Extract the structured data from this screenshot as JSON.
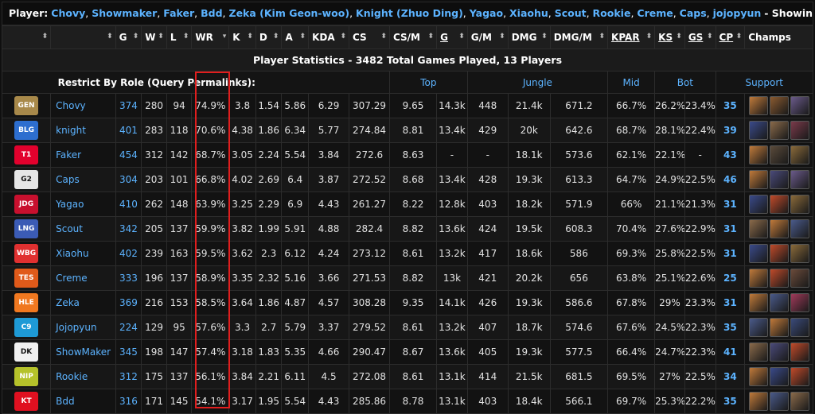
{
  "filter_bar": {
    "label": "Player:",
    "players": [
      "Chovy",
      "Showmaker",
      "Faker",
      "Bdd",
      "Zeka (Kim Geon-woo)",
      "Knight (Zhuo Ding)",
      "Yagao",
      "Xiaohu",
      "Scout",
      "Rookie",
      "Creme",
      "Caps",
      "jojopyun"
    ],
    "suffix": "- Showing Values Per Game"
  },
  "caption": "Player Statistics - 3482 Total Games Played, 13 Players",
  "role_bar": {
    "label": "Restrict By Role (Query Permalinks):",
    "roles": [
      "Top",
      "Jungle",
      "Mid",
      "Bot",
      "Support"
    ]
  },
  "columns": [
    "",
    "",
    "G",
    "W",
    "L",
    "WR",
    "K",
    "D",
    "A",
    "KDA",
    "CS",
    "CS/M",
    "G",
    "G/M",
    "DMG",
    "DMG/M",
    "KPAR",
    "KS",
    "GS",
    "CP",
    "Champs"
  ],
  "sorted_column": "WR",
  "rows": [
    {
      "team": "GEN",
      "team_color": "#a8894a",
      "name": "Chovy",
      "g": "374",
      "w": "280",
      "l": "94",
      "wr": "74.9%",
      "k": "3.8",
      "d": "1.54",
      "a": "5.86",
      "kda": "6.29",
      "cs": "307.29",
      "csm": "9.65",
      "gold": "14.3k",
      "gm": "448",
      "dmg": "21.4k",
      "dmgm": "671.2",
      "kpar": "66.7%",
      "ks": "26.2%",
      "gs": "23.4%",
      "cp": "35",
      "champs": [
        "#c07a3a",
        "#8a5a30",
        "#6a5a8a"
      ]
    },
    {
      "team": "BLG",
      "team_color": "#2d6ecf",
      "name": "knight",
      "g": "401",
      "w": "283",
      "l": "118",
      "wr": "70.6%",
      "k": "4.38",
      "d": "1.86",
      "a": "6.34",
      "kda": "5.77",
      "cs": "274.84",
      "csm": "8.81",
      "gold": "13.4k",
      "gm": "429",
      "dmg": "20k",
      "dmgm": "642.6",
      "kpar": "68.7%",
      "ks": "28.1%",
      "gs": "22.4%",
      "cp": "39",
      "champs": [
        "#3a4a8a",
        "#8a6a4a",
        "#7a3a4a"
      ]
    },
    {
      "team": "T1",
      "team_color": "#e2012d",
      "name": "Faker",
      "g": "454",
      "w": "312",
      "l": "142",
      "wr": "68.7%",
      "k": "3.05",
      "d": "2.24",
      "a": "5.54",
      "kda": "3.84",
      "cs": "272.6",
      "csm": "8.63",
      "gold": "-",
      "gm": "-",
      "dmg": "18.1k",
      "dmgm": "573.6",
      "kpar": "62.1%",
      "ks": "22.1%",
      "gs": "-",
      "cp": "43",
      "champs": [
        "#c07a3a",
        "#5a4a3a",
        "#8a6a3a"
      ]
    },
    {
      "team": "G2",
      "team_color": "#e6e6e6",
      "name": "Caps",
      "g": "304",
      "w": "203",
      "l": "101",
      "wr": "66.8%",
      "k": "4.02",
      "d": "2.69",
      "a": "6.4",
      "kda": "3.87",
      "cs": "272.52",
      "csm": "8.68",
      "gold": "13.4k",
      "gm": "428",
      "dmg": "19.3k",
      "dmgm": "613.3",
      "kpar": "64.7%",
      "ks": "24.9%",
      "gs": "22.5%",
      "cp": "46",
      "champs": [
        "#c07a3a",
        "#4a4a7a",
        "#6a5a8a"
      ]
    },
    {
      "team": "JDG",
      "team_color": "#c8102e",
      "name": "Yagao",
      "g": "410",
      "w": "262",
      "l": "148",
      "wr": "63.9%",
      "k": "3.25",
      "d": "2.29",
      "a": "6.9",
      "kda": "4.43",
      "cs": "261.27",
      "csm": "8.22",
      "gold": "12.8k",
      "gm": "403",
      "dmg": "18.2k",
      "dmgm": "571.9",
      "kpar": "66%",
      "ks": "21.1%",
      "gs": "21.3%",
      "cp": "31",
      "champs": [
        "#3a4a8a",
        "#c04a2a",
        "#8a6a3a"
      ]
    },
    {
      "team": "LNG",
      "team_color": "#3b5bb5",
      "name": "Scout",
      "g": "342",
      "w": "205",
      "l": "137",
      "wr": "59.9%",
      "k": "3.82",
      "d": "1.99",
      "a": "5.91",
      "kda": "4.88",
      "cs": "282.4",
      "csm": "8.82",
      "gold": "13.6k",
      "gm": "424",
      "dmg": "19.5k",
      "dmgm": "608.3",
      "kpar": "70.4%",
      "ks": "27.6%",
      "gs": "22.9%",
      "cp": "31",
      "champs": [
        "#8a6a4a",
        "#c07a3a",
        "#4a5a8a"
      ]
    },
    {
      "team": "WBG",
      "team_color": "#e03030",
      "name": "Xiaohu",
      "g": "402",
      "w": "239",
      "l": "163",
      "wr": "59.5%",
      "k": "3.62",
      "d": "2.3",
      "a": "6.12",
      "kda": "4.24",
      "cs": "273.12",
      "csm": "8.61",
      "gold": "13.2k",
      "gm": "417",
      "dmg": "18.6k",
      "dmgm": "586",
      "kpar": "69.3%",
      "ks": "25.8%",
      "gs": "22.5%",
      "cp": "31",
      "champs": [
        "#3a4a8a",
        "#c04a2a",
        "#8a6a3a"
      ]
    },
    {
      "team": "TES",
      "team_color": "#e05a1a",
      "name": "Creme",
      "g": "333",
      "w": "196",
      "l": "137",
      "wr": "58.9%",
      "k": "3.35",
      "d": "2.32",
      "a": "5.16",
      "kda": "3.66",
      "cs": "271.53",
      "csm": "8.82",
      "gold": "13k",
      "gm": "421",
      "dmg": "20.2k",
      "dmgm": "656",
      "kpar": "63.8%",
      "ks": "25.1%",
      "gs": "22.6%",
      "cp": "25",
      "champs": [
        "#c07a3a",
        "#c04a2a",
        "#6a4a3a"
      ]
    },
    {
      "team": "HLE",
      "team_color": "#f07820",
      "name": "Zeka",
      "g": "369",
      "w": "216",
      "l": "153",
      "wr": "58.5%",
      "k": "3.64",
      "d": "1.86",
      "a": "4.87",
      "kda": "4.57",
      "cs": "308.28",
      "csm": "9.35",
      "gold": "14.1k",
      "gm": "426",
      "dmg": "19.3k",
      "dmgm": "586.6",
      "kpar": "67.8%",
      "ks": "29%",
      "gs": "23.3%",
      "cp": "31",
      "champs": [
        "#c07a3a",
        "#4a5a8a",
        "#a03a5a"
      ]
    },
    {
      "team": "C9",
      "team_color": "#1e9ad6",
      "name": "Jojopyun",
      "g": "224",
      "w": "129",
      "l": "95",
      "wr": "57.6%",
      "k": "3.3",
      "d": "2.7",
      "a": "5.79",
      "kda": "3.37",
      "cs": "279.52",
      "csm": "8.61",
      "gold": "13.2k",
      "gm": "407",
      "dmg": "18.7k",
      "dmgm": "574.6",
      "kpar": "67.6%",
      "ks": "24.5%",
      "gs": "22.3%",
      "cp": "35",
      "champs": [
        "#4a5a8a",
        "#c07a3a",
        "#3a4a7a"
      ]
    },
    {
      "team": "DK",
      "team_color": "#f0f0f0",
      "name": "ShowMaker",
      "g": "345",
      "w": "198",
      "l": "147",
      "wr": "57.4%",
      "k": "3.18",
      "d": "1.83",
      "a": "5.35",
      "kda": "4.66",
      "cs": "290.47",
      "csm": "8.67",
      "gold": "13.6k",
      "gm": "405",
      "dmg": "19.3k",
      "dmgm": "577.5",
      "kpar": "66.4%",
      "ks": "24.7%",
      "gs": "22.3%",
      "cp": "41",
      "champs": [
        "#8a6a4a",
        "#4a4a7a",
        "#c04a2a"
      ]
    },
    {
      "team": "NIP",
      "team_color": "#b5c22a",
      "name": "Rookie",
      "g": "312",
      "w": "175",
      "l": "137",
      "wr": "56.1%",
      "k": "3.84",
      "d": "2.21",
      "a": "6.11",
      "kda": "4.5",
      "cs": "272.08",
      "csm": "8.61",
      "gold": "13.1k",
      "gm": "414",
      "dmg": "21.5k",
      "dmgm": "681.5",
      "kpar": "69.5%",
      "ks": "27%",
      "gs": "22.5%",
      "cp": "34",
      "champs": [
        "#c07a3a",
        "#3a4a8a",
        "#c04a2a"
      ]
    },
    {
      "team": "KT",
      "team_color": "#e01020",
      "name": "Bdd",
      "g": "316",
      "w": "171",
      "l": "145",
      "wr": "54.1%",
      "k": "3.17",
      "d": "1.95",
      "a": "5.54",
      "kda": "4.43",
      "cs": "285.86",
      "csm": "8.78",
      "gold": "13.1k",
      "gm": "403",
      "dmg": "18.4k",
      "dmgm": "566.1",
      "kpar": "69.7%",
      "ks": "25.3%",
      "gs": "22.2%",
      "cp": "35",
      "champs": [
        "#c07a3a",
        "#4a5a8a",
        "#8a6a4a"
      ]
    }
  ]
}
